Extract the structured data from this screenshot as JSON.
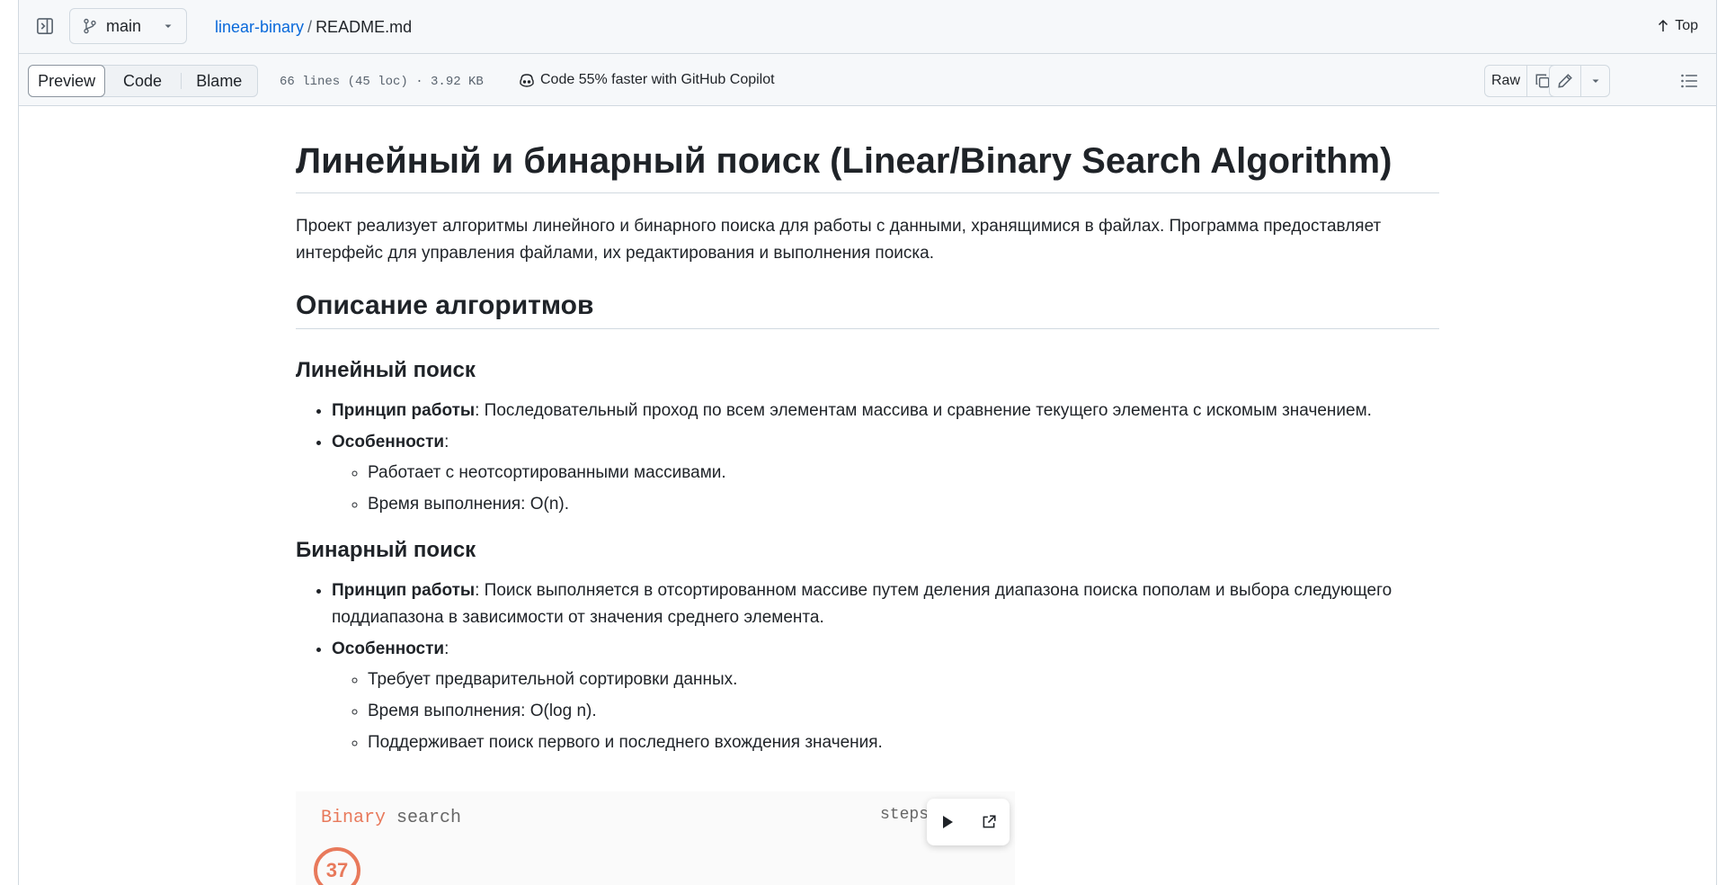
{
  "header": {
    "branch": "main",
    "repo": "linear-binary",
    "separator": "/",
    "file": "README.md",
    "top_label": "Top"
  },
  "toolbar": {
    "tabs": [
      "Preview",
      "Code",
      "Blame"
    ],
    "active_tab": "Preview",
    "file_meta": "66 lines (45 loc) · 3.92 KB",
    "copilot_text": "Code 55% faster with GitHub Copilot",
    "raw_label": "Raw"
  },
  "icons": {
    "sidebar": "sidebar-toggle-icon",
    "branch": "git-branch-icon",
    "copilot": "copilot-icon",
    "copy": "copy-icon",
    "download": "download-icon",
    "edit": "pencil-icon",
    "outline": "list-unordered-icon",
    "play": "play-icon",
    "external": "link-external-icon"
  },
  "article": {
    "title": "Линейный и бинарный поиск (Linear/Binary Search Algorithm)",
    "intro": "Проект реализует алгоритмы линейного и бинарного поиска для работы с данными, хранящимися в файлах. Программа предоставляет интерфейс для управления файлами, их редактирования и выполнения поиска.",
    "section_heading": "Описание алгоритмов",
    "linear": {
      "heading": "Линейный поиск",
      "principle_label": "Принцип работы",
      "principle_text": ": Последовательный проход по всем элементам массива и сравнение текущего элемента с искомым значением.",
      "features_label": "Особенности",
      "features_colon": ":",
      "features": [
        "Работает с неотсортированными массивами.",
        "Время выполнения: O(n)."
      ]
    },
    "binary": {
      "heading": "Бинарный поиск",
      "principle_label": "Принцип работы",
      "principle_text": ": Поиск выполняется в отсортированном массиве путем деления диапазона поиска пополам и выбора следующего поддиапазона в зависимости от значения среднего элемента.",
      "features_label": "Особенности",
      "features_colon": ":",
      "features": [
        "Требует предварительной сортировки данных.",
        "Время выполнения: O(log n).",
        "Поддерживает поиск первого и последнего вхождения значения."
      ]
    }
  },
  "animation": {
    "title_highlight": "Binary",
    "title_rest": " search",
    "steps_label": "steps",
    "target_value": "37"
  },
  "colors": {
    "link": "#0969da",
    "border": "#d1d9e0",
    "accent": "#e8795b"
  }
}
